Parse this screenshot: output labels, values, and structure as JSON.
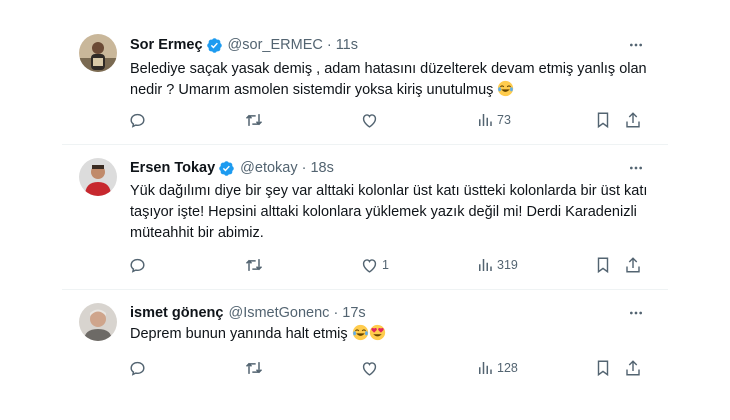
{
  "tweets": [
    {
      "name": "Sor Ermeç",
      "handle": "@sor_ERMEC",
      "separator": "·",
      "time": "11s",
      "text": "Belediye saçak yasak demiş , adam hatasını düzelterek devam etmiş yanlış olan nedir ? Umarım asmolen sistemdir yoksa kiriş unutulmuş",
      "emojis": [
        "face-with-tears-of-joy"
      ],
      "replies": "",
      "retweets": "",
      "likes": "",
      "views": "73"
    },
    {
      "name": "Ersen Tokay",
      "handle": "@etokay",
      "separator": "·",
      "time": "18s",
      "text": "Yük dağılımı diye bir şey var alttaki kolonlar üst katı üstteki kolonlarda bir üst katı taşıyor işte! Hepsini alttaki kolonlara yüklemek yazık değil mi! Derdi Karadenizli müteahhit bir abimiz.",
      "emojis": [],
      "replies": "",
      "retweets": "",
      "likes": "1",
      "views": "319"
    },
    {
      "name": "ismet gönenç",
      "handle": "@IsmetGonenc",
      "separator": "·",
      "time": "17s",
      "text": "Deprem bunun yanında halt etmiş",
      "emojis": [
        "face-with-tears-of-joy",
        "smiling-face-with-heart-eyes"
      ],
      "replies": "",
      "retweets": "",
      "likes": "",
      "views": "128"
    }
  ],
  "colors": {
    "text": "#0f1419",
    "muted": "#536471",
    "verified": "#1d9bf0",
    "divider": "#eff3f4"
  }
}
